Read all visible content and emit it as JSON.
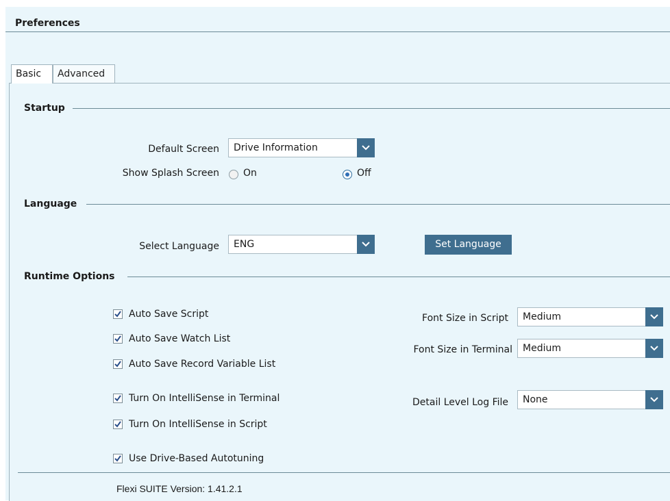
{
  "window": {
    "title": "Preferences"
  },
  "tabs": [
    {
      "label": "Basic",
      "active": true
    },
    {
      "label": "Advanced",
      "active": false
    }
  ],
  "startup": {
    "section_label": "Startup",
    "default_screen": {
      "label": "Default Screen",
      "value": "Drive Information"
    },
    "splash": {
      "label": "Show Splash Screen",
      "on_label": "On",
      "off_label": "Off",
      "selected": "Off"
    }
  },
  "language": {
    "section_label": "Language",
    "select_label": "Select Language",
    "value": "ENG",
    "set_button": "Set Language"
  },
  "runtime": {
    "section_label": "Runtime Options",
    "checkboxes": [
      {
        "label": "Auto Save Script",
        "checked": true
      },
      {
        "label": "Auto Save Watch List",
        "checked": true
      },
      {
        "label": "Auto Save Record Variable List",
        "checked": true
      },
      {
        "label": "Turn On IntelliSense in Terminal",
        "checked": true
      },
      {
        "label": "Turn On IntelliSense in Script",
        "checked": true
      },
      {
        "label": "Use Drive-Based Autotuning",
        "checked": true
      }
    ],
    "font_size_script": {
      "label": "Font Size in Script",
      "value": "Medium"
    },
    "font_size_terminal": {
      "label": "Font Size in Terminal",
      "value": "Medium"
    },
    "log_level": {
      "label": "Detail Level Log File",
      "value": "None"
    }
  },
  "footer": {
    "version_text": "Flexi SUITE Version: 1.41.2.1"
  },
  "colors": {
    "accent": "#3f6e8f",
    "panel": "#eaf6fb",
    "radio_selected": "#2f6fb6"
  },
  "icons": {
    "dropdown": "chevron-down-icon",
    "check": "checkmark-icon"
  }
}
